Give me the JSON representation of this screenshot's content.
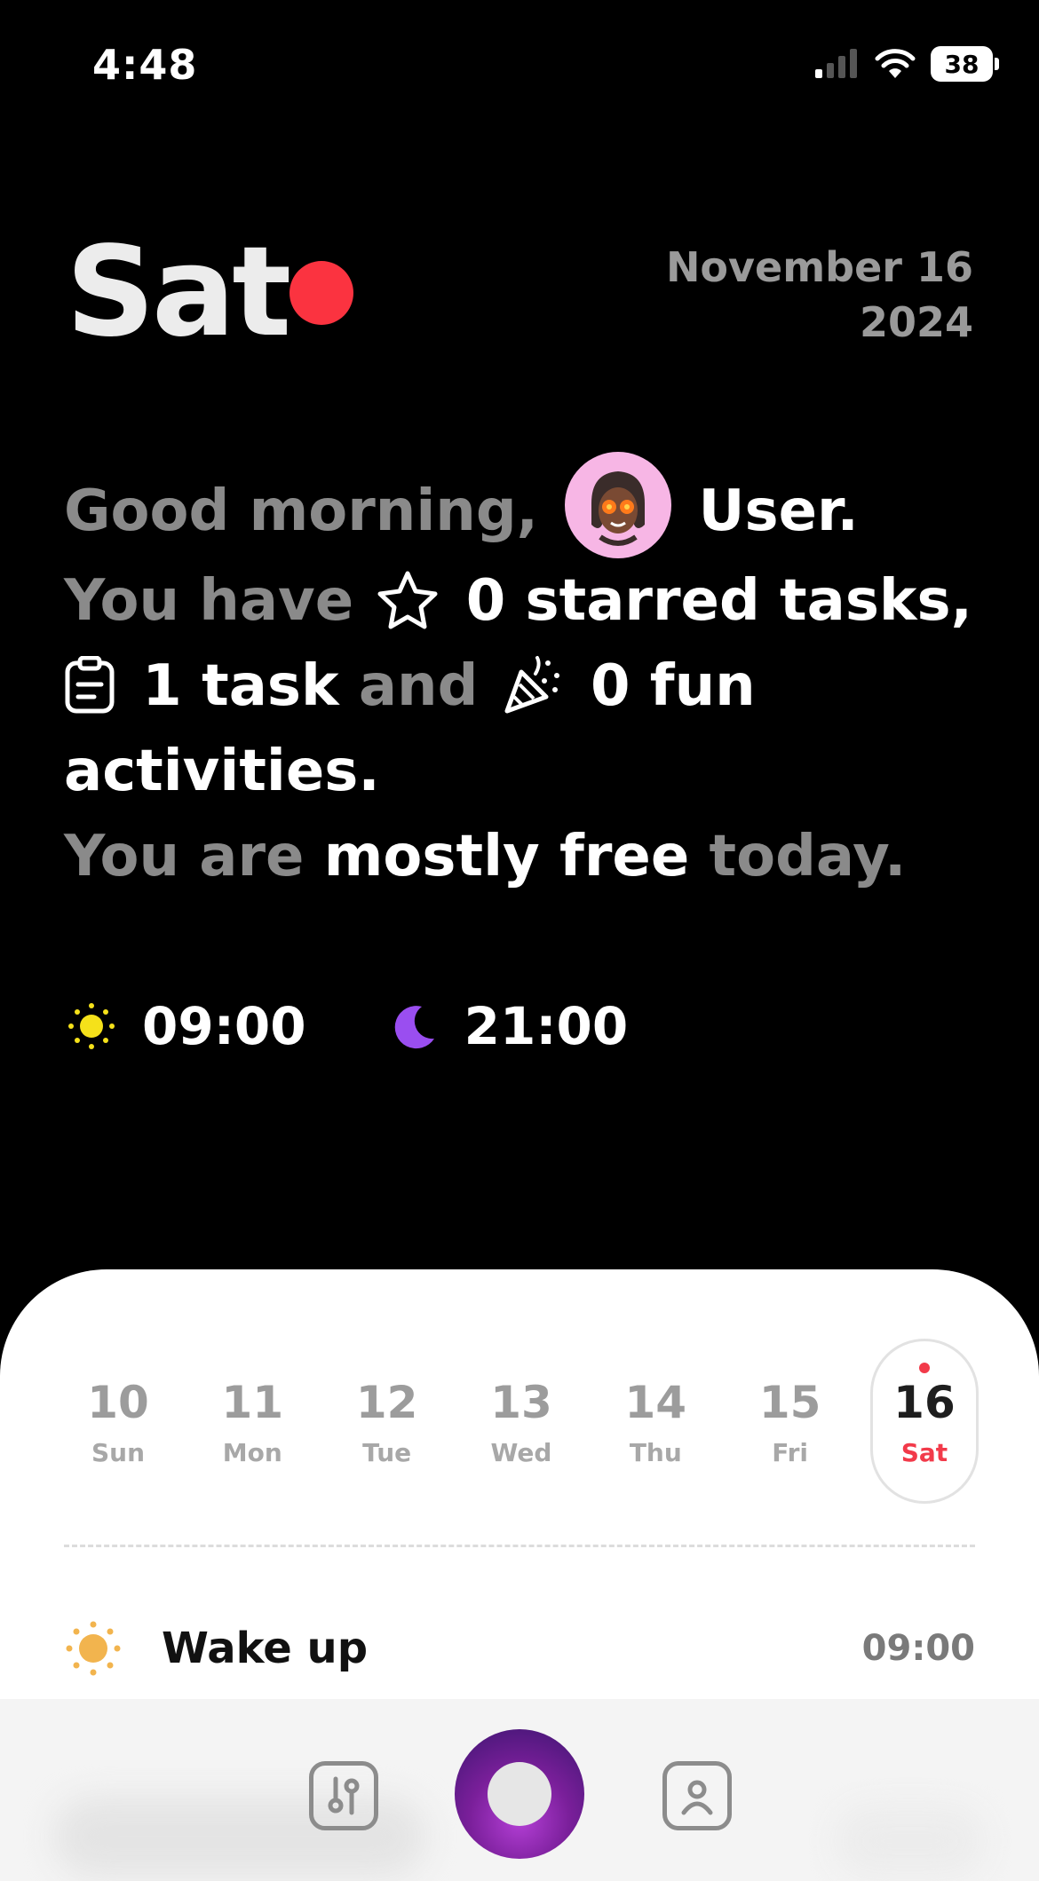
{
  "status": {
    "time": "4:48",
    "battery": "38"
  },
  "header": {
    "day": "Sat",
    "date_line1": "November 16",
    "date_line2": "2024"
  },
  "summary": {
    "greeting": "Good morning,",
    "user_name": "User.",
    "you_have": "You have",
    "starred": "0 starred tasks,",
    "tasks": "1 task",
    "and": "and",
    "fun": "0 fun",
    "activities": "activities.",
    "you_are": "You are",
    "free_status": "mostly free",
    "today": "today."
  },
  "times": {
    "wake": "09:00",
    "sleep": "21:00"
  },
  "week": [
    {
      "num": "10",
      "name": "Sun"
    },
    {
      "num": "11",
      "name": "Mon"
    },
    {
      "num": "12",
      "name": "Tue"
    },
    {
      "num": "13",
      "name": "Wed"
    },
    {
      "num": "14",
      "name": "Thu"
    },
    {
      "num": "15",
      "name": "Fri"
    },
    {
      "num": "16",
      "name": "Sat"
    }
  ],
  "event": {
    "title": "Wake up",
    "time": "09:00"
  },
  "colors": {
    "accent": "#fb3340",
    "sun": "#f5e11a",
    "moon": "#9a4ef0",
    "avatar_bg": "#f7b6e5"
  },
  "icons": [
    "cellular-icon",
    "wifi-icon",
    "star-icon",
    "clipboard-icon",
    "party-popper-icon",
    "sun-icon",
    "moon-icon",
    "settings-icon",
    "profile-icon"
  ]
}
